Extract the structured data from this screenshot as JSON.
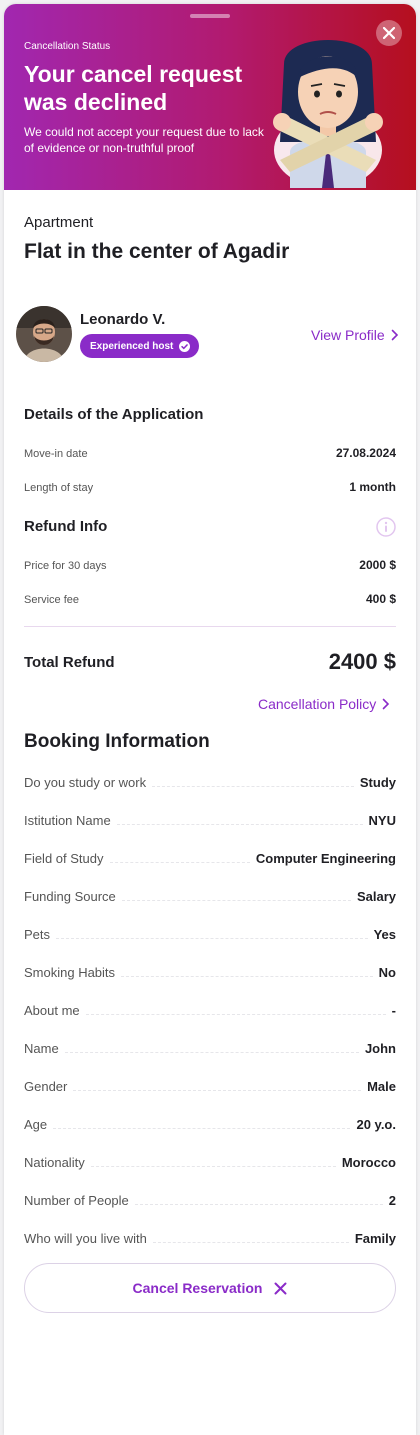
{
  "banner": {
    "status_label": "Cancellation Status",
    "title": "Your cancel request was declined",
    "subtitle": "We could not accept your request due to lack of evidence or non-truthful proof"
  },
  "listing": {
    "type": "Apartment",
    "title": "Flat in the center of Agadir"
  },
  "host": {
    "name": "Leonardo V.",
    "badge": "Experienced host",
    "view_profile": "View Profile"
  },
  "application": {
    "heading": "Details of the Application",
    "move_in_label": "Move-in date",
    "move_in_value": "27.08.2024",
    "length_label": "Length of stay",
    "length_value": "1 month"
  },
  "refund": {
    "heading": "Refund Info",
    "price_label": "Price for 30 days",
    "price_value": "2000 $",
    "fee_label": "Service fee",
    "fee_value": "400 $",
    "total_label": "Total Refund",
    "total_value": "2400 $",
    "policy_link": "Cancellation Policy"
  },
  "booking": {
    "heading": "Booking Information",
    "rows": [
      {
        "label": "Do you study or work",
        "value": "Study"
      },
      {
        "label": "Istitution Name",
        "value": "NYU"
      },
      {
        "label": "Field of Study",
        "value": "Computer Engineering"
      },
      {
        "label": "Funding Source",
        "value": "Salary"
      },
      {
        "label": "Pets",
        "value": "Yes"
      },
      {
        "label": "Smoking Habits",
        "value": "No"
      },
      {
        "label": "About me",
        "value": "-"
      },
      {
        "label": "Name",
        "value": "John"
      },
      {
        "label": "Gender",
        "value": "Male"
      },
      {
        "label": "Age",
        "value": "20 y.o."
      },
      {
        "label": "Nationality",
        "value": "Morocco"
      },
      {
        "label": "Number of People",
        "value": "2"
      },
      {
        "label": "Who will you live with",
        "value": "Family"
      }
    ]
  },
  "actions": {
    "cancel_label": "Cancel Reservation"
  },
  "colors": {
    "accent": "#8a2bc8",
    "banner_start": "#a127b0",
    "banner_end": "#b50f1e"
  },
  "icons": {
    "close": "close-icon",
    "verified": "verified-check-icon",
    "chevron": "chevron-right-icon",
    "info": "info-icon",
    "cancel": "x-icon"
  }
}
